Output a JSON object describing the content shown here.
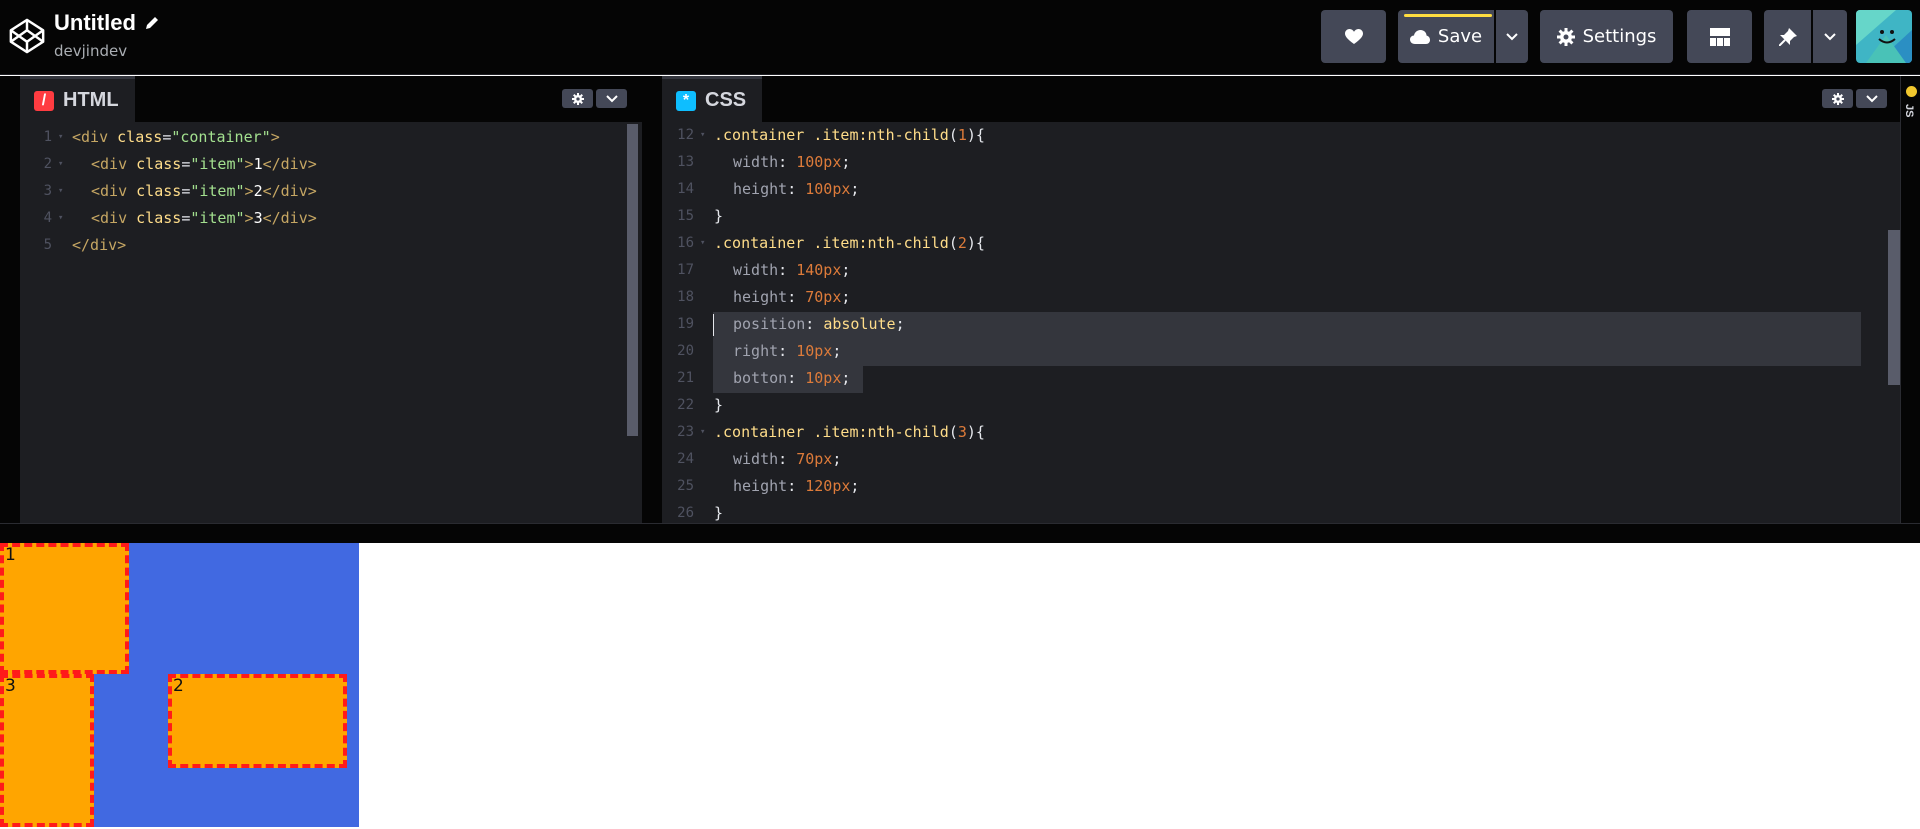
{
  "header": {
    "title": "Untitled",
    "username": "devjindev",
    "save_label": "Save",
    "settings_label": "Settings"
  },
  "colors": {
    "header_bg": "#050505",
    "button_bg": "#444857",
    "editor_bg": "#1d1e22",
    "save_accent": "#ffdd40",
    "html_icon": "#ff3c41",
    "css_icon": "#0ebeff",
    "js_icon": "#fcd000",
    "preview_container": "#4169e1",
    "item_fill": "#ffa500",
    "item_border": "#ff1a1a"
  },
  "icons": [
    "codepen-logo-icon",
    "pencil-icon",
    "heart-icon",
    "cloud-icon",
    "chevron-down-icon",
    "gear-icon",
    "layout-icon",
    "pin-icon",
    "avatar"
  ],
  "html_editor": {
    "tab_label": "HTML",
    "lines": [
      {
        "n": "1",
        "fold": true,
        "indent": 0,
        "tokens": [
          [
            "<div ",
            "tag"
          ],
          [
            "class",
            "attr"
          ],
          [
            "=",
            "punc"
          ],
          [
            "\"container\"",
            "str"
          ],
          [
            ">",
            "tag"
          ]
        ]
      },
      {
        "n": "2",
        "fold": true,
        "indent": 1,
        "tokens": [
          [
            "<div ",
            "tag"
          ],
          [
            "class",
            "attr"
          ],
          [
            "=",
            "punc"
          ],
          [
            "\"item\"",
            "str"
          ],
          [
            ">",
            "tag"
          ],
          [
            "1",
            "text"
          ],
          [
            "</div>",
            "tag"
          ]
        ]
      },
      {
        "n": "3",
        "fold": true,
        "indent": 1,
        "tokens": [
          [
            "<div ",
            "tag"
          ],
          [
            "class",
            "attr"
          ],
          [
            "=",
            "punc"
          ],
          [
            "\"item\"",
            "str"
          ],
          [
            ">",
            "tag"
          ],
          [
            "2",
            "text"
          ],
          [
            "</div>",
            "tag"
          ]
        ]
      },
      {
        "n": "4",
        "fold": true,
        "indent": 1,
        "tokens": [
          [
            "<div ",
            "tag"
          ],
          [
            "class",
            "attr"
          ],
          [
            "=",
            "punc"
          ],
          [
            "\"item\"",
            "str"
          ],
          [
            ">",
            "tag"
          ],
          [
            "3",
            "text"
          ],
          [
            "</div>",
            "tag"
          ]
        ]
      },
      {
        "n": "5",
        "fold": false,
        "indent": 0,
        "tokens": [
          [
            "</div>",
            "tag"
          ]
        ]
      }
    ]
  },
  "css_editor": {
    "tab_label": "CSS",
    "lines": [
      {
        "n": "12",
        "fold": true,
        "indent": 0,
        "tokens": [
          [
            ".container .item",
            "sel"
          ],
          [
            ":nth-child",
            "pseudo"
          ],
          [
            "(",
            "punc"
          ],
          [
            "1",
            "num"
          ],
          [
            ")",
            "punc"
          ],
          [
            "{",
            "punc"
          ]
        ]
      },
      {
        "n": "13",
        "fold": false,
        "indent": 1,
        "tokens": [
          [
            "width",
            "prop"
          ],
          [
            ": ",
            "punc"
          ],
          [
            "100px",
            "num"
          ],
          [
            ";",
            "punc"
          ]
        ]
      },
      {
        "n": "14",
        "fold": false,
        "indent": 1,
        "tokens": [
          [
            "height",
            "prop"
          ],
          [
            ": ",
            "punc"
          ],
          [
            "100px",
            "num"
          ],
          [
            ";",
            "punc"
          ]
        ]
      },
      {
        "n": "15",
        "fold": false,
        "indent": 0,
        "tokens": [
          [
            "}",
            "punc"
          ]
        ]
      },
      {
        "n": "16",
        "fold": true,
        "indent": 0,
        "tokens": [
          [
            ".container .item",
            "sel"
          ],
          [
            ":nth-child",
            "pseudo"
          ],
          [
            "(",
            "punc"
          ],
          [
            "2",
            "num"
          ],
          [
            ")",
            "punc"
          ],
          [
            "{",
            "punc"
          ]
        ]
      },
      {
        "n": "17",
        "fold": false,
        "indent": 1,
        "tokens": [
          [
            "width",
            "prop"
          ],
          [
            ": ",
            "punc"
          ],
          [
            "140px",
            "num"
          ],
          [
            ";",
            "punc"
          ]
        ]
      },
      {
        "n": "18",
        "fold": false,
        "indent": 1,
        "tokens": [
          [
            "height",
            "prop"
          ],
          [
            ": ",
            "punc"
          ],
          [
            "70px",
            "num"
          ],
          [
            ";",
            "punc"
          ]
        ]
      },
      {
        "n": "19",
        "fold": false,
        "indent": 1,
        "tokens": [
          [
            "position",
            "prop"
          ],
          [
            ": ",
            "punc"
          ],
          [
            "absolute",
            "val"
          ],
          [
            ";",
            "punc"
          ]
        ]
      },
      {
        "n": "20",
        "fold": false,
        "indent": 1,
        "tokens": [
          [
            "right",
            "prop"
          ],
          [
            ": ",
            "punc"
          ],
          [
            "10px",
            "num"
          ],
          [
            ";",
            "punc"
          ]
        ]
      },
      {
        "n": "21",
        "fold": false,
        "indent": 1,
        "tokens": [
          [
            "botton",
            "prop"
          ],
          [
            ": ",
            "punc"
          ],
          [
            "10px",
            "num"
          ],
          [
            ";",
            "punc"
          ]
        ]
      },
      {
        "n": "22",
        "fold": false,
        "indent": 0,
        "tokens": [
          [
            "}",
            "punc"
          ]
        ]
      },
      {
        "n": "23",
        "fold": true,
        "indent": 0,
        "tokens": [
          [
            ".container .item",
            "sel"
          ],
          [
            ":nth-child",
            "pseudo"
          ],
          [
            "(",
            "punc"
          ],
          [
            "3",
            "num"
          ],
          [
            ")",
            "punc"
          ],
          [
            "{",
            "punc"
          ]
        ]
      },
      {
        "n": "24",
        "fold": false,
        "indent": 1,
        "tokens": [
          [
            "width",
            "prop"
          ],
          [
            ": ",
            "punc"
          ],
          [
            "70px",
            "num"
          ],
          [
            ";",
            "punc"
          ]
        ]
      },
      {
        "n": "25",
        "fold": false,
        "indent": 1,
        "tokens": [
          [
            "height",
            "prop"
          ],
          [
            ": ",
            "punc"
          ],
          [
            "120px",
            "num"
          ],
          [
            ";",
            "punc"
          ]
        ]
      },
      {
        "n": "26",
        "fold": false,
        "indent": 0,
        "tokens": [
          [
            "}",
            "punc"
          ]
        ]
      }
    ]
  },
  "js_editor": {
    "tab_label": "JS"
  },
  "preview": {
    "items": [
      {
        "label": "1"
      },
      {
        "label": "2"
      },
      {
        "label": "3"
      }
    ]
  }
}
